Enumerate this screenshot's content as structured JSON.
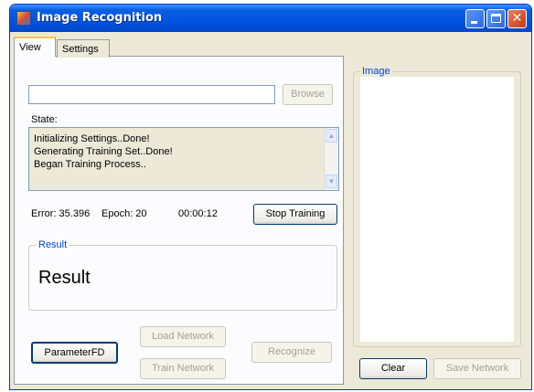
{
  "window": {
    "title": "Image Recognition",
    "controls": {
      "minimize_icon": "minimize-icon",
      "maximize_icon": "maximize-icon",
      "close_glyph": "✕"
    }
  },
  "tabs": [
    {
      "label": "View",
      "active": true
    },
    {
      "label": "Settings",
      "active": false
    }
  ],
  "view": {
    "file_path_value": "",
    "browse_label": "Browse",
    "state_label": "State:",
    "state_log": [
      "Initializing Settings..Done!",
      "Generating Training Set..Done!",
      "Began Training Process.."
    ],
    "error_text": "Error: 35.396",
    "epoch_text": "Epoch: 20",
    "time_text": "00:00:12",
    "stop_training_label": "Stop Training",
    "result_group_title": "Result",
    "result_value": "Result",
    "parameter_fd_label": "ParameterFD",
    "load_network_label": "Load Network",
    "train_network_label": "Train Network",
    "recognize_label": "Recognize"
  },
  "image_panel": {
    "title": "Image",
    "clear_label": "Clear",
    "save_network_label": "Save Network"
  },
  "colors": {
    "titlebar": "#0054e3",
    "group_title": "#0046d5",
    "window_bg": "#ece9d8"
  }
}
